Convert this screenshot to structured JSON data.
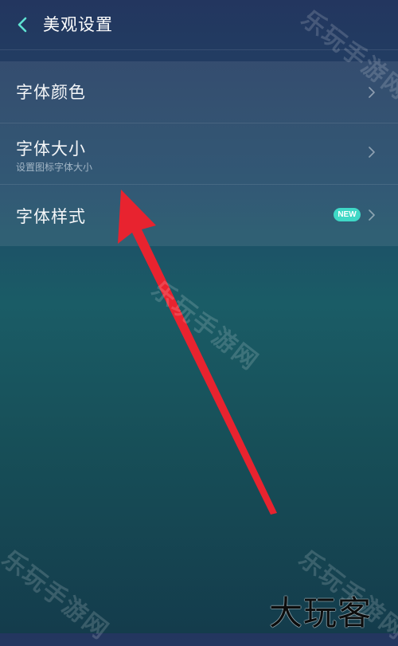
{
  "header": {
    "title": "美观设置",
    "back_icon": "chevron-left-icon"
  },
  "items": [
    {
      "label": "字体颜色",
      "subtitle": ""
    },
    {
      "label": "字体大小",
      "subtitle": "设置图标字体大小"
    },
    {
      "label": "字体样式",
      "subtitle": "",
      "badge": "NEW"
    }
  ],
  "colors": {
    "accent": "#5fe3d2",
    "badge": "#3fd8c6",
    "annotation_arrow": "#e8232f"
  },
  "watermarks": [
    "乐玩手游网",
    "乐玩手游网",
    "乐玩手游网",
    "乐玩手游网"
  ],
  "logo_text": "大玩客"
}
